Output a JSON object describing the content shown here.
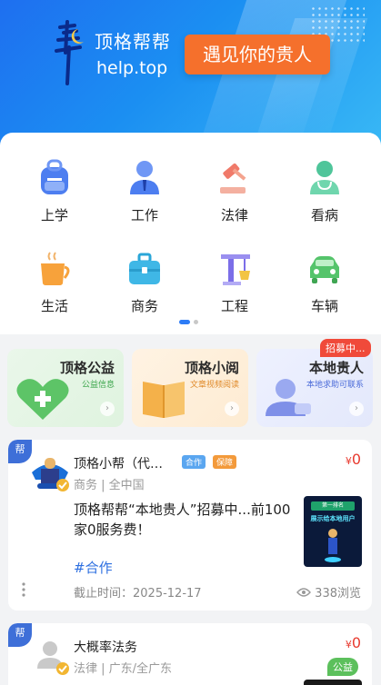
{
  "banner": {
    "brand_name": "顶格帮帮",
    "domain": "help.top",
    "slogan": "遇见你的贵人"
  },
  "categories": [
    {
      "label": "上学",
      "icon": "backpack-icon"
    },
    {
      "label": "工作",
      "icon": "worker-icon"
    },
    {
      "label": "法律",
      "icon": "gavel-icon"
    },
    {
      "label": "看病",
      "icon": "doctor-icon"
    },
    {
      "label": "生活",
      "icon": "coffee-cup-icon"
    },
    {
      "label": "商务",
      "icon": "briefcase-icon"
    },
    {
      "label": "工程",
      "icon": "crane-icon"
    },
    {
      "label": "车辆",
      "icon": "car-icon"
    }
  ],
  "features": [
    {
      "title": "顶格公益",
      "subtitle": "公益信息",
      "icon": "heart-plus-icon"
    },
    {
      "title": "顶格小阅",
      "subtitle": "文章视频阅读",
      "icon": "book-icon"
    },
    {
      "title": "本地贵人",
      "subtitle": "本地求助可联系",
      "icon": "person-icon",
      "badge": "招募中..."
    }
  ],
  "posts": [
    {
      "corner": "帮",
      "name": "顶格小帮（代…",
      "tags": [
        "合作",
        "保障"
      ],
      "meta": "商务 | 全中国",
      "price_symbol": "¥",
      "price": "0",
      "content": "顶格帮帮“本地贵人”招募中...前100家0服务费！",
      "thumb_line1": "第一排名",
      "thumb_line2": "展示给本地用户",
      "hashtag": "#合作",
      "deadline": "截止时间：2025-12-17",
      "views": "338浏览"
    },
    {
      "corner": "帮",
      "name": "大概率法务",
      "tag": "公益",
      "meta": "法律 | 广东/全广东",
      "price_symbol": "¥",
      "price": "0"
    }
  ],
  "colors": {
    "primary": "#2d7cf6",
    "slogan_bg": "#f5702c",
    "price": "#e83a2f",
    "badge_red": "#f04a3a",
    "tag_green": "#5cc05c"
  }
}
